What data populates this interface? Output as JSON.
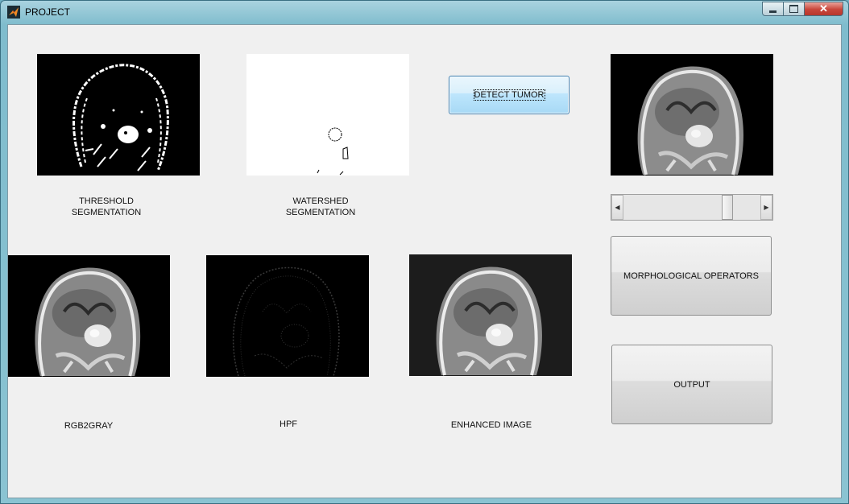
{
  "window": {
    "title": "PROJECT"
  },
  "labels": {
    "threshold": "THRESHOLD\nSEGMENTATION",
    "watershed": "WATERSHED\nSEGMENTATION",
    "rgb2gray": "RGB2GRAY",
    "hpf": "HPF",
    "enhanced": "ENHANCED IMAGE"
  },
  "buttons": {
    "detect_tumor": "DETECT TUMOR",
    "morphological": "MORPHOLOGICAL OPERATORS",
    "output": "OUTPUT"
  },
  "slider": {
    "value": 0.78
  },
  "icons": {
    "app": "matlab-icon",
    "minimize": "minimize-icon",
    "maximize": "maximize-icon",
    "close": "close-icon",
    "left": "arrow-left-icon",
    "right": "arrow-right-icon"
  }
}
